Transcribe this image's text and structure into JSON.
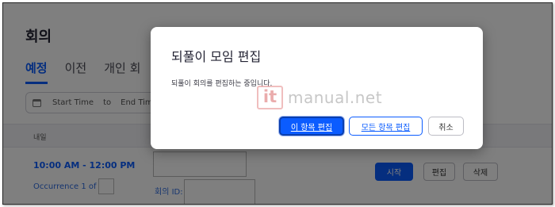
{
  "page": {
    "title": "회의"
  },
  "tabs": [
    {
      "label": "예정"
    },
    {
      "label": "이전"
    },
    {
      "label": "개인 회"
    }
  ],
  "date_range": {
    "start_placeholder": "Start Time",
    "separator": "to",
    "end_placeholder": "End Time"
  },
  "day_header": {
    "label": "내일"
  },
  "meeting": {
    "time": "10:00 AM - 12:00 PM",
    "occurrence_label": "Occurrence 1 of",
    "meeting_id_label": "회의 ID:",
    "start_button": "시작",
    "edit_button": "편집",
    "delete_button": "삭제"
  },
  "dialog": {
    "title": "되풀이 모임 편집",
    "message": "되풀이 회의를 편집하는 중입니다.",
    "this_item_button": "이 항목 편집",
    "all_items_button": "모든 항목 편집",
    "cancel_button": "취소"
  },
  "watermark": {
    "logo": "it",
    "text": "manual.net"
  },
  "colors": {
    "accent": "#0b5cff",
    "overlay": "rgba(0,0,0,0.5)"
  }
}
